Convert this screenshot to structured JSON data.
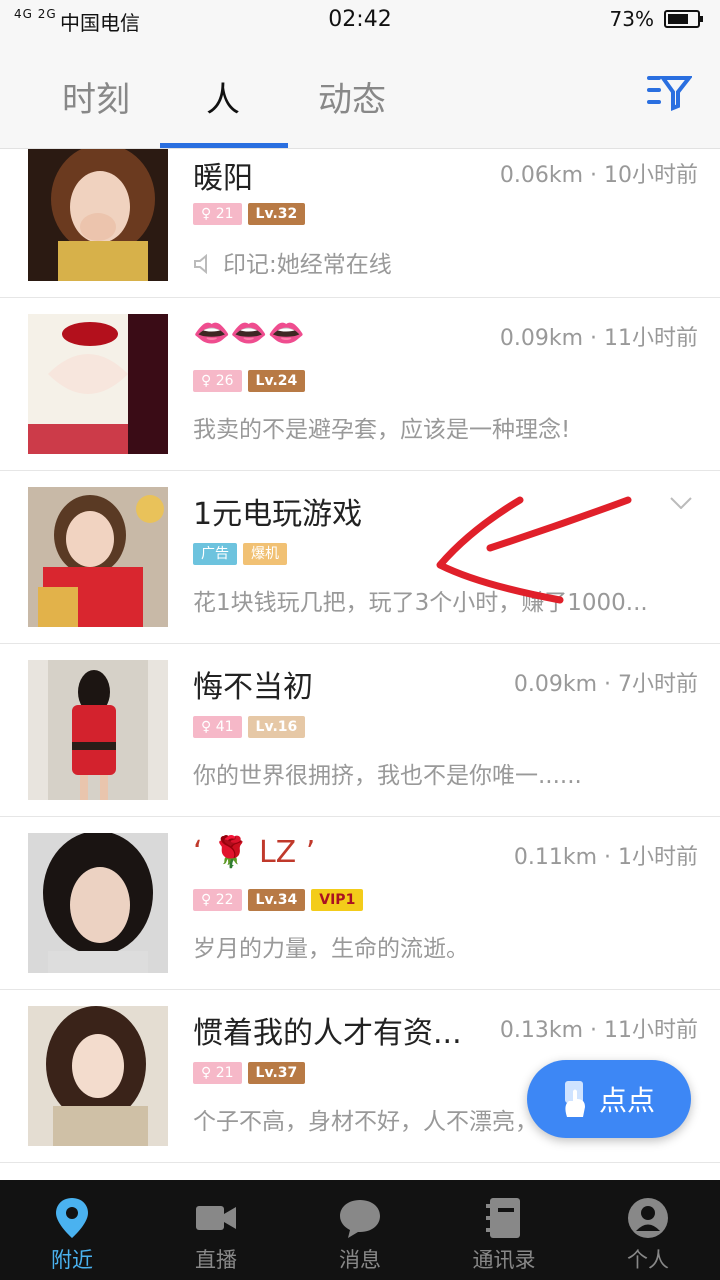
{
  "status_bar": {
    "network": "4G 2G",
    "carrier": "中国电信",
    "time": "02:42",
    "battery": "73%",
    "battery_level": 0.73
  },
  "tabs": [
    {
      "label": "时刻"
    },
    {
      "label": "人"
    },
    {
      "label": "动态"
    }
  ],
  "active_tab": "人",
  "people": [
    {
      "name": "暖阳",
      "meta": "0.06km · 10小时前",
      "age": "21",
      "level": "Lv.32",
      "signature": "印记:她经常在线"
    },
    {
      "name": "👄👄👄",
      "meta": "0.09km · 11小时前",
      "age": "26",
      "level": "Lv.24",
      "signature": "我卖的不是避孕套，应该是一种理念!"
    },
    {
      "name": "1元电玩游戏",
      "tags": [
        "广告",
        "爆机"
      ],
      "signature": "花1块钱玩几把，玩了3个小时，赚了1000..."
    },
    {
      "name": "悔不当初",
      "meta": "0.09km · 7小时前",
      "age": "41",
      "level": "Lv.16",
      "signature": "你的世界很拥挤，我也不是你唯一......"
    },
    {
      "name": "‘ 🌹        LZ ’",
      "meta": "0.11km · 1小时前",
      "age": "22",
      "level": "Lv.34",
      "vip": "VIP1",
      "signature": "岁月的力量，生命的流逝。"
    },
    {
      "name": "惯着我的人才有资...",
      "meta": "0.13km · 11小时前",
      "age": "21",
      "level": "Lv.37",
      "signature": "个子不高，身材不好，人不漂亮，"
    }
  ],
  "fab": {
    "label": "点点"
  },
  "bottom_nav": [
    {
      "label": "附近"
    },
    {
      "label": "直播"
    },
    {
      "label": "消息"
    },
    {
      "label": "通讯录"
    },
    {
      "label": "个人"
    }
  ],
  "colors": {
    "accent": "#2a6fe0",
    "fab": "#3d87f5",
    "active_nav": "#4ab2f0",
    "bottom_bar": "#121212",
    "annotation_arrow": "#e0202a"
  }
}
